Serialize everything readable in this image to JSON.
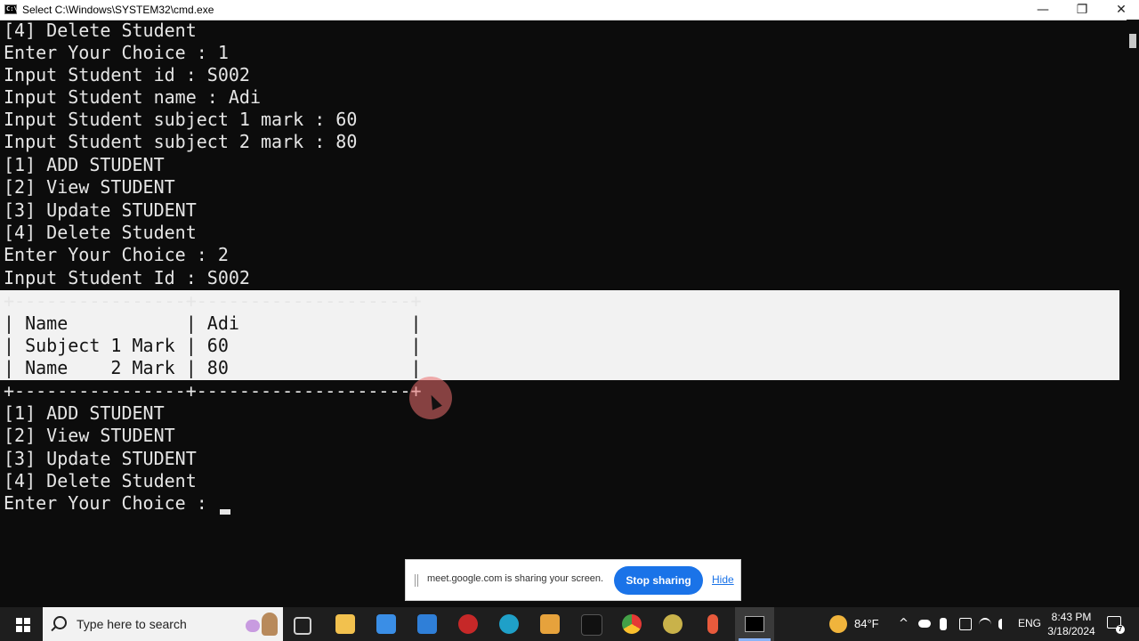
{
  "window": {
    "title": "Select C:\\Windows\\SYSTEM32\\cmd.exe",
    "icon_label": "C:\\",
    "minimize_glyph": "—",
    "maximize_glyph": "❐",
    "close_glyph": "✕"
  },
  "console": {
    "lines_top": [
      "[4] Delete Student",
      "Enter Your Choice : 1",
      "Input Student id : S002",
      "Input Student name : Adi",
      "Input Student subject 1 mark : 60",
      "Input Student subject 2 mark : 80",
      "[1] ADD STUDENT",
      "[2] View STUDENT",
      "[3] Update STUDENT",
      "[4] Delete Student",
      "Enter Your Choice : 2",
      "Input Student Id : S002"
    ],
    "table_lines": [
      "+----------------+--------------------+",
      "| Name           | Adi                |",
      "| Subject 1 Mark | 60                 |",
      "| Name    2 Mark | 80                 |",
      "+----------------+--------------------+"
    ],
    "lines_bottom": [
      "[1] ADD STUDENT",
      "[2] View STUDENT",
      "[3] Update STUDENT",
      "[4] Delete Student",
      "Enter Your Choice : "
    ]
  },
  "share_bar": {
    "message": "meet.google.com is sharing your screen.",
    "stop_label": "Stop sharing",
    "hide_label": "Hide"
  },
  "taskbar": {
    "search_placeholder": "Type here to search",
    "temperature": "84°F",
    "language": "ENG",
    "time": "8:43 PM",
    "date": "3/18/2024",
    "notification_count": "7",
    "tray_chevron": "^",
    "apps": [
      {
        "name": "task-view",
        "color": "#cfcfcf"
      },
      {
        "name": "file-explorer",
        "color": "#f2c14e"
      },
      {
        "name": "microsoft-store",
        "color": "#3a8ee6"
      },
      {
        "name": "mail",
        "color": "#2f7fd8"
      },
      {
        "name": "antivirus",
        "color": "#c62828"
      },
      {
        "name": "edge",
        "color": "#1fa0c8"
      },
      {
        "name": "teams-badge",
        "color": "#e6a23c"
      },
      {
        "name": "tiktok",
        "color": "#111111"
      },
      {
        "name": "chrome",
        "color": "#e53935"
      },
      {
        "name": "game-app",
        "color": "#c9b24a"
      },
      {
        "name": "microphone",
        "color": "#e85a3c"
      }
    ]
  }
}
